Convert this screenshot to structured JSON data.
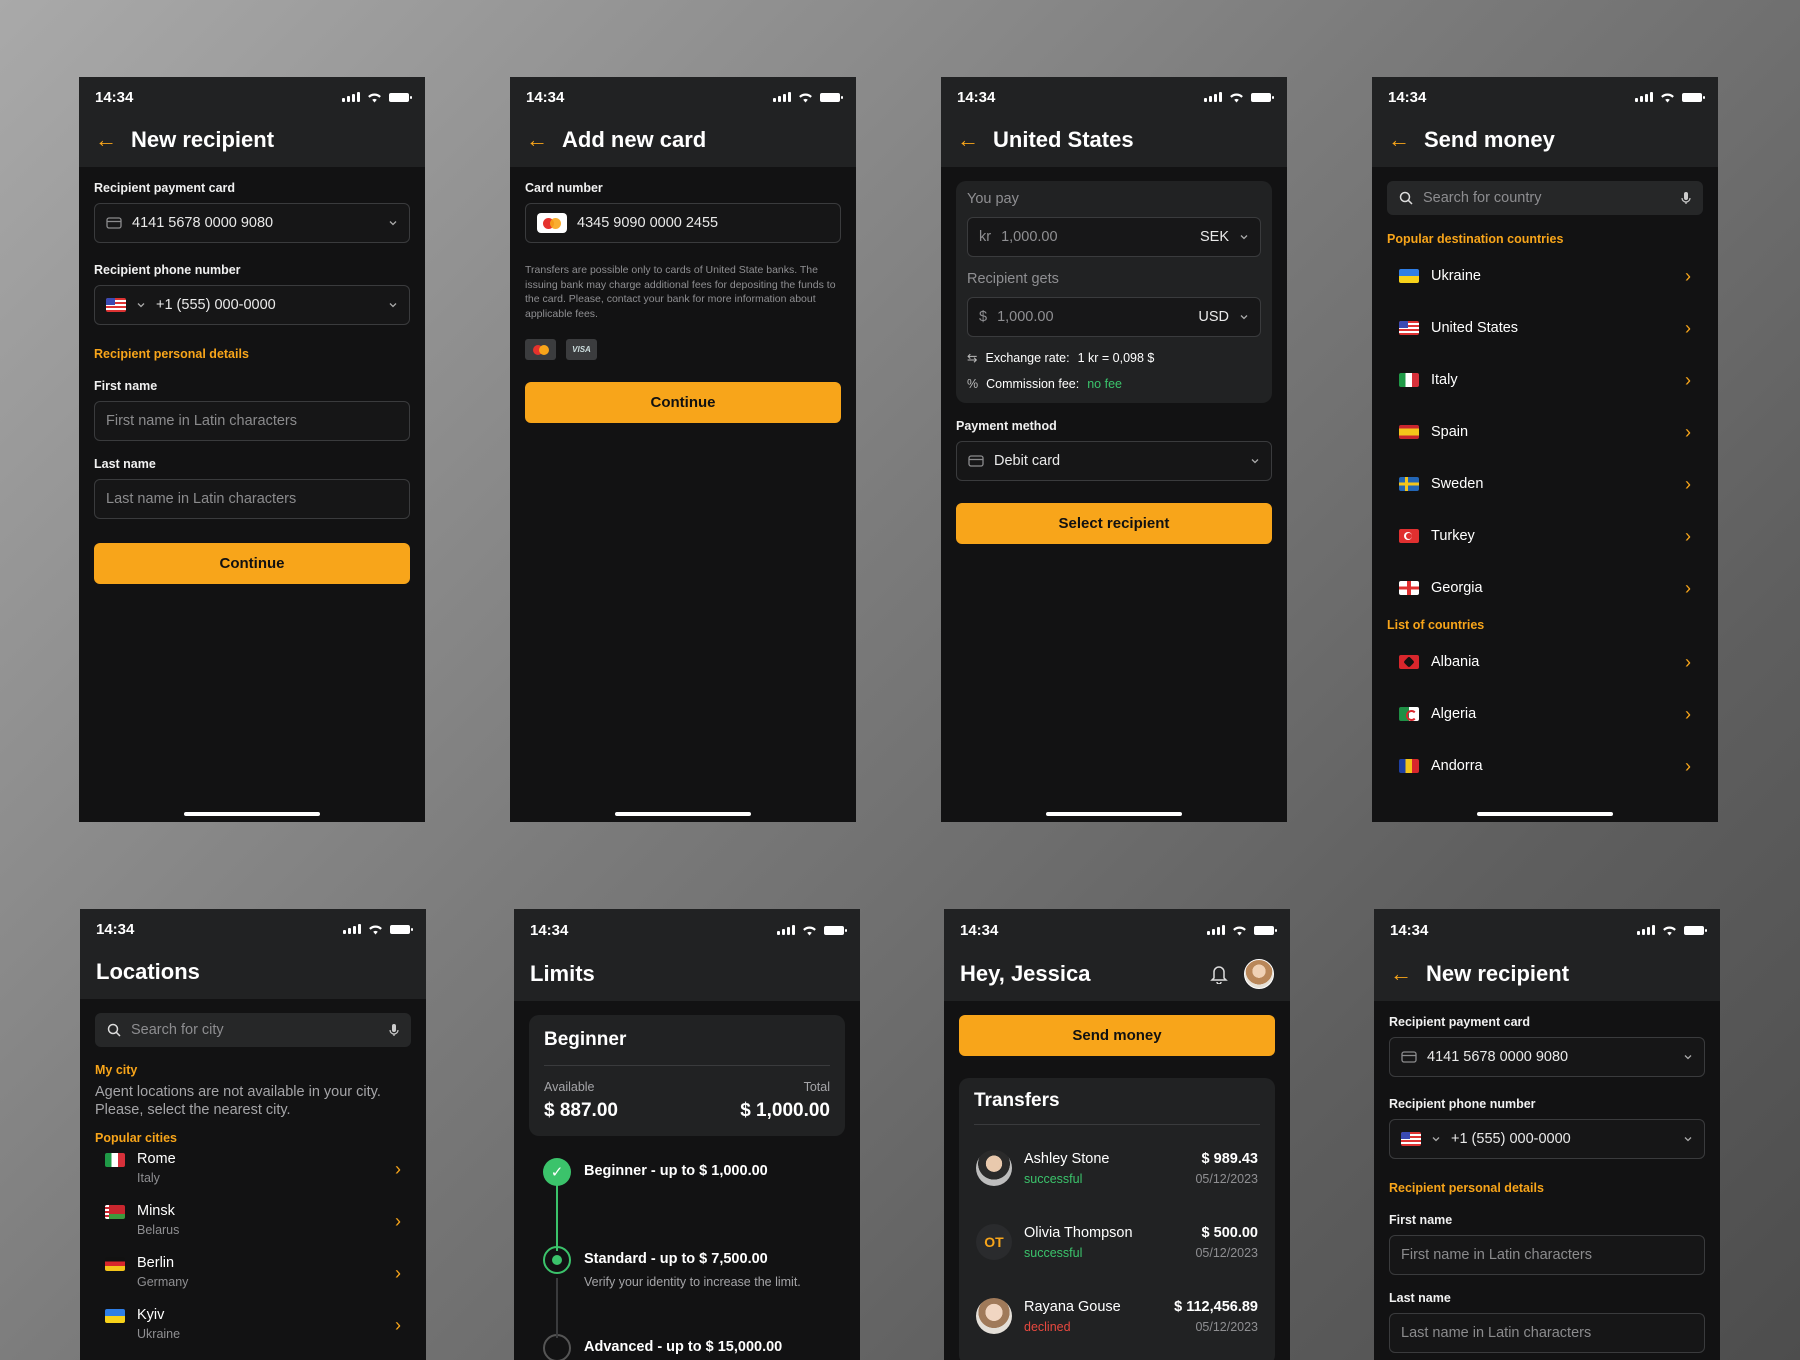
{
  "status_time": "14:34",
  "s1": {
    "title": "New recipient",
    "card_label": "Recipient payment card",
    "card_value": "4141 5678 0000 9080",
    "phone_label": "Recipient phone number",
    "phone_value": "+1 (555) 000-0000",
    "section": "Recipient personal details",
    "first_label": "First name",
    "first_ph": "First name in Latin characters",
    "last_label": "Last name",
    "last_ph": "Last name in Latin characters",
    "continue": "Continue"
  },
  "s2": {
    "title": "Add new card",
    "card_label": "Card number",
    "card_value": "4345 9090 0000 2455",
    "note": "Transfers are possible only to cards of United State banks. The issuing bank may charge additional fees for depositing the funds to the card. Please, contact your bank for more information about applicable fees.",
    "visa": "VISA",
    "continue": "Continue"
  },
  "s3": {
    "title": "United States",
    "you_pay": "You pay",
    "pay_symbol": "kr",
    "pay_value": "1,000.00",
    "pay_currency": "SEK",
    "gets": "Recipient gets",
    "gets_symbol": "$",
    "gets_value": "1,000.00",
    "gets_currency": "USD",
    "rate_label": "Exchange rate:",
    "rate_value": "1 kr = 0,098 $",
    "fee_label": "Commission fee:",
    "fee_value": "no fee",
    "method_label": "Payment method",
    "method_value": "Debit card",
    "select": "Select recipient"
  },
  "s4": {
    "title": "Send money",
    "search_ph": "Search for country",
    "popular": "Popular destination countries",
    "popular_list": [
      "Ukraine",
      "United States",
      "Italy",
      "Spain",
      "Sweden",
      "Turkey",
      "Georgia"
    ],
    "list_title": "List of countries",
    "list": [
      "Albania",
      "Algeria",
      "Andorra"
    ]
  },
  "s5": {
    "title": "Locations",
    "search_ph": "Search for city",
    "my_city": "My city",
    "note": "Agent locations are not available in your city. Please, select the nearest city.",
    "popular": "Popular cities",
    "cities": [
      {
        "city": "Rome",
        "country": "Italy"
      },
      {
        "city": "Minsk",
        "country": "Belarus"
      },
      {
        "city": "Berlin",
        "country": "Germany"
      },
      {
        "city": "Kyiv",
        "country": "Ukraine"
      }
    ]
  },
  "s6": {
    "title": "Limits",
    "level": "Beginner",
    "available_label": "Available",
    "total_label": "Total",
    "available": "$ 887.00",
    "total": "$ 1,000.00",
    "steps": [
      {
        "label": "Beginner - up to $ 1,000.00",
        "sub": ""
      },
      {
        "label": "Standard - up to $ 7,500.00",
        "sub": "Verify your identity to increase the limit."
      },
      {
        "label": "Advanced - up to $ 15,000.00",
        "sub": ""
      }
    ]
  },
  "s7": {
    "title": "Hey, Jessica",
    "send": "Send money",
    "transfers": "Transfers",
    "items": [
      {
        "name": "Ashley Stone",
        "status": "successful",
        "amount": "$ 989.43",
        "date": "05/12/2023",
        "initials": ""
      },
      {
        "name": "Olivia Thompson",
        "status": "successful",
        "amount": "$ 500.00",
        "date": "05/12/2023",
        "initials": "OT"
      },
      {
        "name": "Rayana Gouse",
        "status": "declined",
        "amount": "$ 112,456.89",
        "date": "05/12/2023",
        "initials": ""
      }
    ]
  },
  "s8": {
    "title": "New recipient",
    "card_label": "Recipient payment card",
    "card_value": "4141 5678 0000 9080",
    "phone_label": "Recipient phone number",
    "phone_value": "+1 (555) 000-0000",
    "section": "Recipient personal details",
    "first_label": "First name",
    "first_ph": "First name in Latin characters",
    "last_label": "Last name",
    "last_ph": "Last name in Latin characters"
  },
  "colors": {
    "accent": "#f8a51a",
    "success": "#3bc36b",
    "danger": "#e8493f",
    "bg": "#121213",
    "surface": "#212223"
  }
}
